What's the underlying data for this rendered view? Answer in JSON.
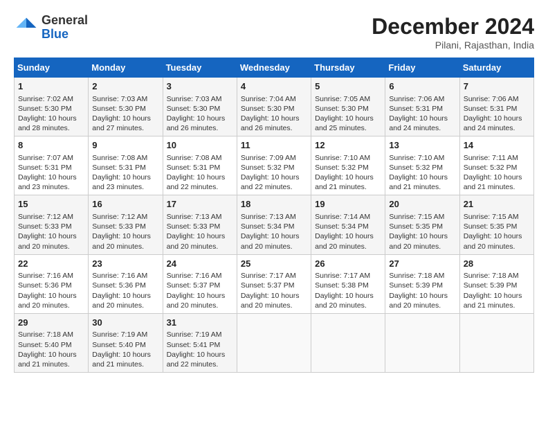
{
  "header": {
    "logo_line1": "General",
    "logo_line2": "Blue",
    "title": "December 2024",
    "subtitle": "Pilani, Rajasthan, India"
  },
  "calendar": {
    "days_of_week": [
      "Sunday",
      "Monday",
      "Tuesday",
      "Wednesday",
      "Thursday",
      "Friday",
      "Saturday"
    ],
    "weeks": [
      [
        {
          "day": "1",
          "sunrise": "7:02 AM",
          "sunset": "5:30 PM",
          "daylight": "10 hours and 28 minutes."
        },
        {
          "day": "2",
          "sunrise": "7:03 AM",
          "sunset": "5:30 PM",
          "daylight": "10 hours and 27 minutes."
        },
        {
          "day": "3",
          "sunrise": "7:03 AM",
          "sunset": "5:30 PM",
          "daylight": "10 hours and 26 minutes."
        },
        {
          "day": "4",
          "sunrise": "7:04 AM",
          "sunset": "5:30 PM",
          "daylight": "10 hours and 26 minutes."
        },
        {
          "day": "5",
          "sunrise": "7:05 AM",
          "sunset": "5:30 PM",
          "daylight": "10 hours and 25 minutes."
        },
        {
          "day": "6",
          "sunrise": "7:06 AM",
          "sunset": "5:31 PM",
          "daylight": "10 hours and 24 minutes."
        },
        {
          "day": "7",
          "sunrise": "7:06 AM",
          "sunset": "5:31 PM",
          "daylight": "10 hours and 24 minutes."
        }
      ],
      [
        {
          "day": "8",
          "sunrise": "7:07 AM",
          "sunset": "5:31 PM",
          "daylight": "10 hours and 23 minutes."
        },
        {
          "day": "9",
          "sunrise": "7:08 AM",
          "sunset": "5:31 PM",
          "daylight": "10 hours and 23 minutes."
        },
        {
          "day": "10",
          "sunrise": "7:08 AM",
          "sunset": "5:31 PM",
          "daylight": "10 hours and 22 minutes."
        },
        {
          "day": "11",
          "sunrise": "7:09 AM",
          "sunset": "5:32 PM",
          "daylight": "10 hours and 22 minutes."
        },
        {
          "day": "12",
          "sunrise": "7:10 AM",
          "sunset": "5:32 PM",
          "daylight": "10 hours and 21 minutes."
        },
        {
          "day": "13",
          "sunrise": "7:10 AM",
          "sunset": "5:32 PM",
          "daylight": "10 hours and 21 minutes."
        },
        {
          "day": "14",
          "sunrise": "7:11 AM",
          "sunset": "5:32 PM",
          "daylight": "10 hours and 21 minutes."
        }
      ],
      [
        {
          "day": "15",
          "sunrise": "7:12 AM",
          "sunset": "5:33 PM",
          "daylight": "10 hours and 20 minutes."
        },
        {
          "day": "16",
          "sunrise": "7:12 AM",
          "sunset": "5:33 PM",
          "daylight": "10 hours and 20 minutes."
        },
        {
          "day": "17",
          "sunrise": "7:13 AM",
          "sunset": "5:33 PM",
          "daylight": "10 hours and 20 minutes."
        },
        {
          "day": "18",
          "sunrise": "7:13 AM",
          "sunset": "5:34 PM",
          "daylight": "10 hours and 20 minutes."
        },
        {
          "day": "19",
          "sunrise": "7:14 AM",
          "sunset": "5:34 PM",
          "daylight": "10 hours and 20 minutes."
        },
        {
          "day": "20",
          "sunrise": "7:15 AM",
          "sunset": "5:35 PM",
          "daylight": "10 hours and 20 minutes."
        },
        {
          "day": "21",
          "sunrise": "7:15 AM",
          "sunset": "5:35 PM",
          "daylight": "10 hours and 20 minutes."
        }
      ],
      [
        {
          "day": "22",
          "sunrise": "7:16 AM",
          "sunset": "5:36 PM",
          "daylight": "10 hours and 20 minutes."
        },
        {
          "day": "23",
          "sunrise": "7:16 AM",
          "sunset": "5:36 PM",
          "daylight": "10 hours and 20 minutes."
        },
        {
          "day": "24",
          "sunrise": "7:16 AM",
          "sunset": "5:37 PM",
          "daylight": "10 hours and 20 minutes."
        },
        {
          "day": "25",
          "sunrise": "7:17 AM",
          "sunset": "5:37 PM",
          "daylight": "10 hours and 20 minutes."
        },
        {
          "day": "26",
          "sunrise": "7:17 AM",
          "sunset": "5:38 PM",
          "daylight": "10 hours and 20 minutes."
        },
        {
          "day": "27",
          "sunrise": "7:18 AM",
          "sunset": "5:39 PM",
          "daylight": "10 hours and 20 minutes."
        },
        {
          "day": "28",
          "sunrise": "7:18 AM",
          "sunset": "5:39 PM",
          "daylight": "10 hours and 21 minutes."
        }
      ],
      [
        {
          "day": "29",
          "sunrise": "7:18 AM",
          "sunset": "5:40 PM",
          "daylight": "10 hours and 21 minutes."
        },
        {
          "day": "30",
          "sunrise": "7:19 AM",
          "sunset": "5:40 PM",
          "daylight": "10 hours and 21 minutes."
        },
        {
          "day": "31",
          "sunrise": "7:19 AM",
          "sunset": "5:41 PM",
          "daylight": "10 hours and 22 minutes."
        },
        null,
        null,
        null,
        null
      ]
    ]
  }
}
